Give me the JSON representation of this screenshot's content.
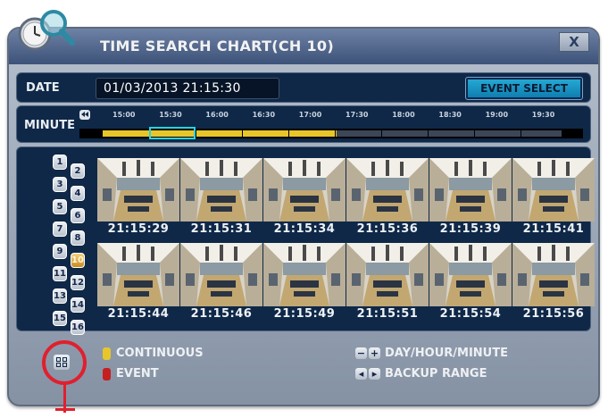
{
  "window": {
    "title": "TIME SEARCH CHART(CH 10)",
    "close_label": "X",
    "logo_icon": "clock-magnifier-icon"
  },
  "date_row": {
    "label": "DATE",
    "value": "01/03/2013 21:15:30",
    "event_select_label": "EVENT SELECT"
  },
  "minute_row": {
    "label": "MINUTE",
    "rewind_icon": "rewind-icon",
    "ticks": [
      "15:00",
      "15:30",
      "16:00",
      "16:30",
      "17:00",
      "17:30",
      "18:00",
      "18:30",
      "19:00",
      "19:30"
    ],
    "continuous_fraction": 0.5,
    "selected_tick": "15:30"
  },
  "channels": [
    "1",
    "2",
    "3",
    "4",
    "5",
    "6",
    "7",
    "8",
    "9",
    "10",
    "11",
    "12",
    "13",
    "14",
    "15",
    "16"
  ],
  "selected_channel": "10",
  "thumbnails": [
    "21:15:29",
    "21:15:31",
    "21:15:34",
    "21:15:36",
    "21:15:39",
    "21:15:41",
    "21:15:44",
    "21:15:46",
    "21:15:49",
    "21:15:51",
    "21:15:54",
    "21:15:56"
  ],
  "legend": {
    "continuous": "CONTINUOUS",
    "event": "EVENT",
    "day_hour_minute": "DAY/HOUR/MINUTE",
    "backup_range": "BACKUP RANGE",
    "continuous_color": "#e8c62a",
    "event_color": "#c61f1f"
  },
  "colors": {
    "panel": "#0f2848",
    "accent": "#2bd3e0",
    "highlight": "#e0202e"
  }
}
